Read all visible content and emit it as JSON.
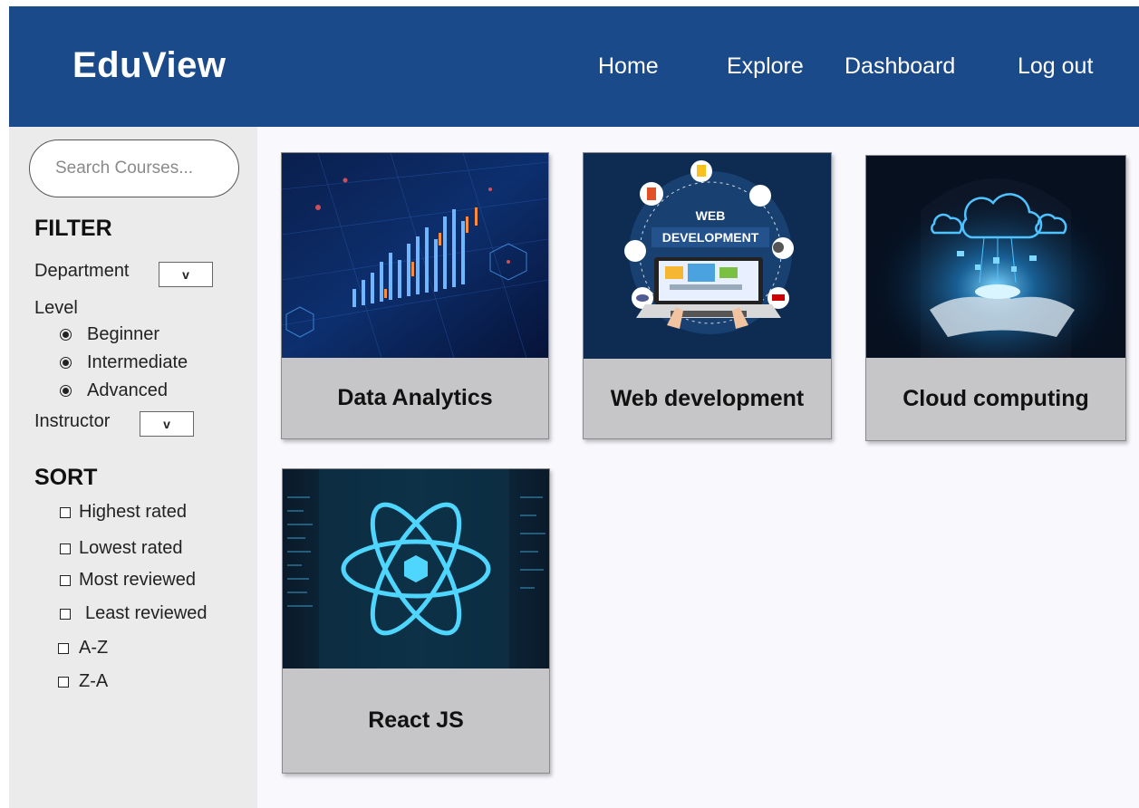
{
  "header": {
    "logo": "EduView",
    "nav": {
      "home": "Home",
      "explore": "Explore",
      "dashboard": "Dashboard",
      "logout": "Log out"
    }
  },
  "sidebar": {
    "search_placeholder": "Search Courses...",
    "filter": {
      "title": "FILTER",
      "department_label": "Department",
      "department_dropdown": "v",
      "level_label": "Level",
      "levels": [
        "Beginner",
        "Intermediate",
        "Advanced"
      ],
      "instructor_label": "Instructor",
      "instructor_dropdown": "v"
    },
    "sort": {
      "title": "SORT",
      "options": [
        "Highest rated",
        "Lowest rated",
        "Most reviewed",
        "Least reviewed",
        "A-Z",
        "Z-A"
      ]
    }
  },
  "courses": [
    {
      "title": "Data Analytics",
      "image": "data-analytics-image"
    },
    {
      "title": "Web development",
      "image": "web-development-image",
      "image_text": [
        "WEB",
        "DEVELOPMENT"
      ]
    },
    {
      "title": "Cloud computing",
      "image": "cloud-computing-image"
    },
    {
      "title": "React JS",
      "image": "react-js-image"
    }
  ],
  "colors": {
    "header_bg": "#1b4a8a",
    "sidebar_bg": "#ebebeb",
    "main_bg": "#f8f8fd",
    "card_caption_bg": "#c6c6c8"
  }
}
